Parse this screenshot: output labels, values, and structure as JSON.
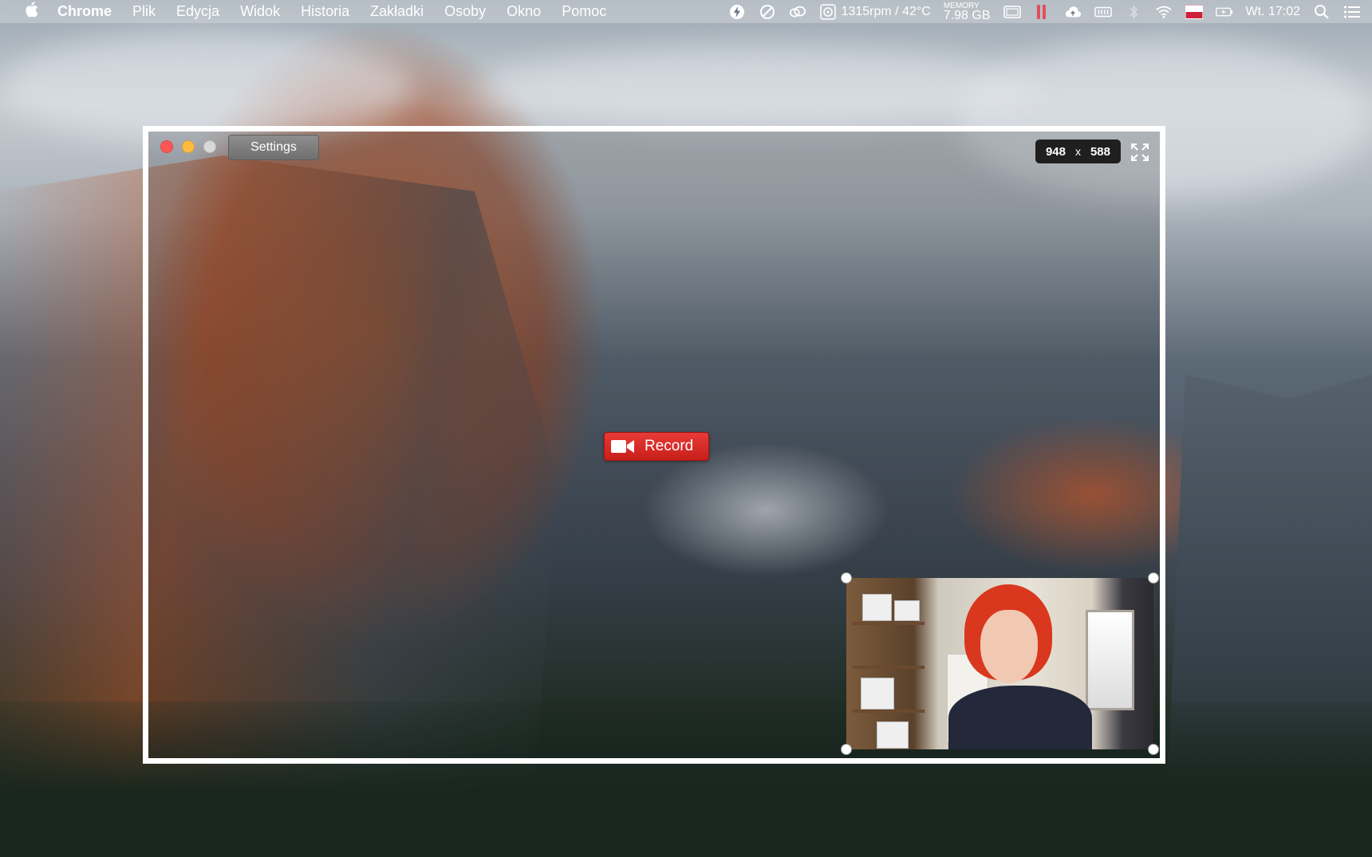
{
  "menubar": {
    "apple_icon": "apple-logo-icon",
    "app_name": "Chrome",
    "items": [
      "Plik",
      "Edycja",
      "Widok",
      "Historia",
      "Zakładki",
      "Osoby",
      "Okno",
      "Pomoc"
    ],
    "status": {
      "fan": "1315rpm / 42°C",
      "memory_label": "MEMORY",
      "memory_value": "7.98 GB",
      "clock": "Wt. 17:02"
    }
  },
  "recorder": {
    "settings_label": "Settings",
    "width": "948",
    "separator": "x",
    "height": "588",
    "record_label": "Record"
  },
  "colors": {
    "record": "#d62a26",
    "window_border": "#ffffff",
    "dims_bg": "#1f1f1f"
  }
}
